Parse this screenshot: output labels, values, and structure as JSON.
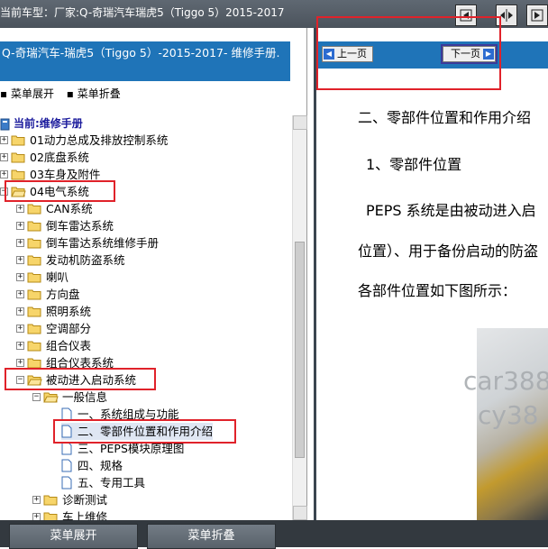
{
  "topbar": {
    "title": "当前车型：厂家:Q-奇瑞汽车瑞虎5（Tiggo 5）2015-2017"
  },
  "left": {
    "header": "Q-奇瑞汽车-瑞虎5（Tiggo 5）-2015-2017- 维修手册.",
    "expand_link": "菜单展开",
    "collapse_link": "菜单折叠",
    "current_label": "当前:维修手册",
    "tree": {
      "i1": "01动力总成及排放控制系统",
      "i2": "02底盘系统",
      "i3": "03车身及附件",
      "i4": "04电气系统",
      "i5": "CAN系统",
      "i6": "倒车雷达系统",
      "i7": "倒车雷达系统维修手册",
      "i8": "发动机防盗系统",
      "i9": "喇叭",
      "i10": "方向盘",
      "i11": "照明系统",
      "i12": "空调部分",
      "i13": "组合仪表",
      "i14": "组合仪表系统",
      "i15": "被动进入启动系统",
      "i16": "一般信息",
      "i17": "一、系统组成与功能",
      "i18": "二、零部件位置和作用介绍",
      "i19": "三、PEPS模块原理图",
      "i20": "四、规格",
      "i21": "五、专用工具",
      "i22": "诊断测试",
      "i23": "车上维修"
    }
  },
  "right": {
    "prev_label": "上一页",
    "next_label": "下一页",
    "heading": "二、零部件位置和作用介绍",
    "sub_heading": "1、零部件位置",
    "para1": "PEPS 系统是由被动进入启",
    "para2": "位置）、用于备份启动的防盗",
    "para3": "各部件位置如下图所示：",
    "watermark1": "car388",
    "watermark2": "cy38"
  },
  "bottom": {
    "expand_button": "菜单展开",
    "collapse_button": "菜单折叠"
  },
  "colors": {
    "header_blue": "#1f74b8",
    "highlight_red": "#e0222a"
  }
}
